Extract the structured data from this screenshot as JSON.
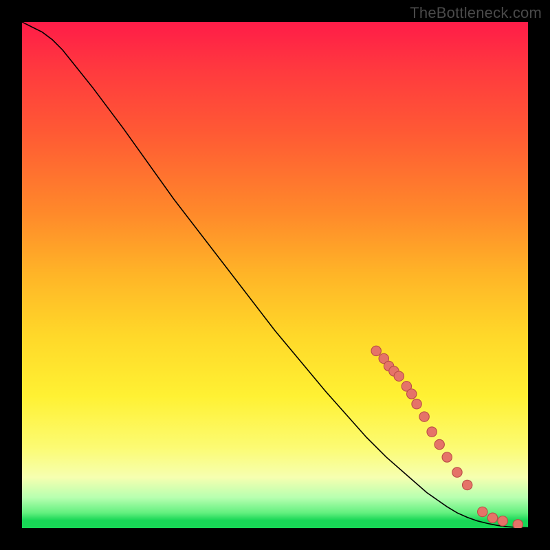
{
  "watermark": "TheBottleneck.com",
  "colors": {
    "page_bg": "#000000",
    "curve": "#000000",
    "dot_fill": "#e57368",
    "dot_stroke": "#b94d45",
    "gradient_stops": [
      "#ff1c48",
      "#ff5a34",
      "#ffb527",
      "#fff133",
      "#f6ffb0",
      "#63f07f",
      "#18d656"
    ]
  },
  "chart_data": {
    "type": "line",
    "title": "",
    "xlabel": "",
    "ylabel": "",
    "xlim": [
      0,
      100
    ],
    "ylim": [
      0,
      100
    ],
    "legend": false,
    "grid": false,
    "series": [
      {
        "name": "curve",
        "show_markers": false,
        "x": [
          0,
          2,
          4,
          6,
          8,
          10,
          14,
          20,
          30,
          40,
          50,
          60,
          68,
          72,
          76,
          80,
          84,
          86,
          88,
          90,
          92,
          94,
          96,
          98,
          100
        ],
        "y": [
          100,
          99,
          98,
          96.5,
          94.5,
          92,
          87,
          79,
          65,
          52,
          39,
          27,
          18,
          14,
          10.5,
          7,
          4.2,
          3,
          2.1,
          1.4,
          0.9,
          0.5,
          0.25,
          0.1,
          0.05
        ]
      },
      {
        "name": "markers",
        "show_markers": true,
        "x": [
          70,
          71.5,
          72.5,
          73.5,
          74.5,
          76,
          77,
          78,
          79.5,
          81,
          82.5,
          84,
          86,
          88,
          91,
          93,
          95,
          98
        ],
        "y": [
          35,
          33.5,
          32,
          31,
          30,
          28,
          26.5,
          24.5,
          22,
          19,
          16.5,
          14,
          11,
          8.5,
          3.2,
          2.0,
          1.4,
          0.7
        ]
      }
    ]
  }
}
